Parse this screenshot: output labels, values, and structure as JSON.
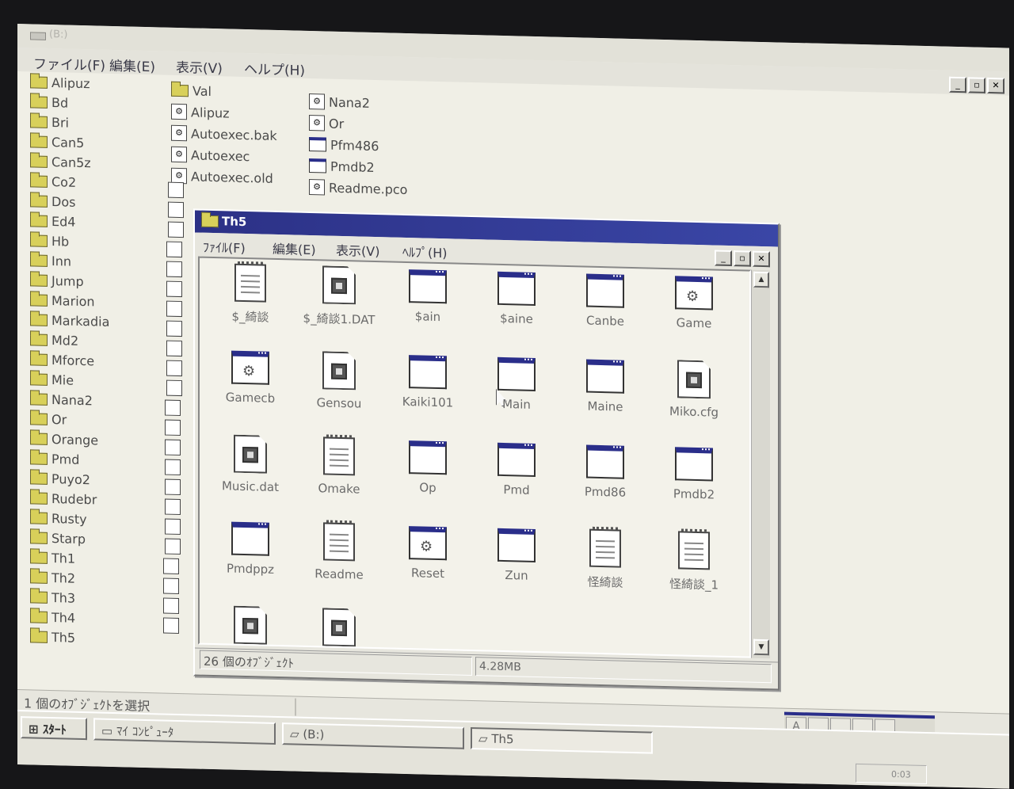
{
  "outer_window": {
    "title": "(B:)",
    "menu": [
      "ファイル(F)",
      "編集(E)",
      "表示(V)",
      "ヘルプ(H)"
    ],
    "folders": [
      "Alipuz",
      "Bd",
      "Bri",
      "Can5",
      "Can5z",
      "Co2",
      "Dos",
      "Ed4",
      "Hb",
      "Inn",
      "Jump",
      "Marion",
      "Markadia",
      "Md2",
      "Mforce",
      "Mie",
      "Nana2",
      "Or",
      "Orange",
      "Pmd",
      "Puyo2",
      "Rudebr",
      "Rusty",
      "Starp",
      "Th1",
      "Th2",
      "Th3",
      "Th4",
      "Th5"
    ],
    "files_col2": [
      {
        "name": "Val",
        "icon": "folder-icon"
      },
      {
        "name": "Alipuz",
        "icon": "system-file-icon"
      },
      {
        "name": "Autoexec.bak",
        "icon": "system-file-icon"
      },
      {
        "name": "Autoexec",
        "icon": "system-file-icon"
      },
      {
        "name": "Autoexec.old",
        "icon": "system-file-icon"
      }
    ],
    "files_col3": [
      {
        "name": "Nana2",
        "icon": "system-file-icon"
      },
      {
        "name": "Or",
        "icon": "system-file-icon"
      },
      {
        "name": "Pfm486",
        "icon": "application-icon"
      },
      {
        "name": "Pmdb2",
        "icon": "application-icon"
      },
      {
        "name": "Readme.pco",
        "icon": "system-file-icon"
      }
    ],
    "status_text": "1 個のｵﾌﾞｼﾞｪｸﾄを選択"
  },
  "th5_window": {
    "title": "Th5",
    "menu": [
      "ﾌｧｲﾙ(F)",
      "編集(E)",
      "表示(V)",
      "ﾍﾙﾌﾟ(H)"
    ],
    "icons": [
      {
        "label": "$_綺談",
        "type": "document"
      },
      {
        "label": "$_綺談1.DAT",
        "type": "system"
      },
      {
        "label": "$ain",
        "type": "application"
      },
      {
        "label": "$aine",
        "type": "application"
      },
      {
        "label": "Canbe",
        "type": "application"
      },
      {
        "label": "Game",
        "type": "application-gear"
      },
      {
        "label": "Gamecb",
        "type": "application-gear"
      },
      {
        "label": "Gensou",
        "type": "system"
      },
      {
        "label": "Kaiki101",
        "type": "application"
      },
      {
        "label": "Main",
        "type": "application"
      },
      {
        "label": "Maine",
        "type": "application"
      },
      {
        "label": "Miko.cfg",
        "type": "system"
      },
      {
        "label": "Music.dat",
        "type": "system"
      },
      {
        "label": "Omake",
        "type": "document"
      },
      {
        "label": "Op",
        "type": "application"
      },
      {
        "label": "Pmd",
        "type": "application"
      },
      {
        "label": "Pmd86",
        "type": "application"
      },
      {
        "label": "Pmdb2",
        "type": "application"
      },
      {
        "label": "Pmdppz",
        "type": "application"
      },
      {
        "label": "Readme",
        "type": "document"
      },
      {
        "label": "Reset",
        "type": "application-gear"
      },
      {
        "label": "Zun",
        "type": "application"
      },
      {
        "label": "怪綺談",
        "type": "document"
      },
      {
        "label": "怪綺談_1",
        "type": "document"
      },
      {
        "label": "",
        "type": "system"
      },
      {
        "label": "",
        "type": "system"
      }
    ],
    "status_count": "26 個のｵﾌﾞｼﾞｪｸﾄ",
    "status_size": "4.28MB"
  },
  "taskbar": {
    "start_label": "ｽﾀｰﾄ",
    "tasks": [
      {
        "label": "ﾏｲ ｺﾝﾋﾟｭｰﾀ",
        "active": false
      },
      {
        "label": "(B:)",
        "active": false
      },
      {
        "label": "Th5",
        "active": true
      }
    ],
    "clock": "0:03",
    "ime_buttons": [
      "A",
      "",
      "",
      "",
      ""
    ]
  },
  "colors": {
    "title_active": "#2c3186",
    "folder": "#d8d05a",
    "desktop": "#f0efe6"
  }
}
